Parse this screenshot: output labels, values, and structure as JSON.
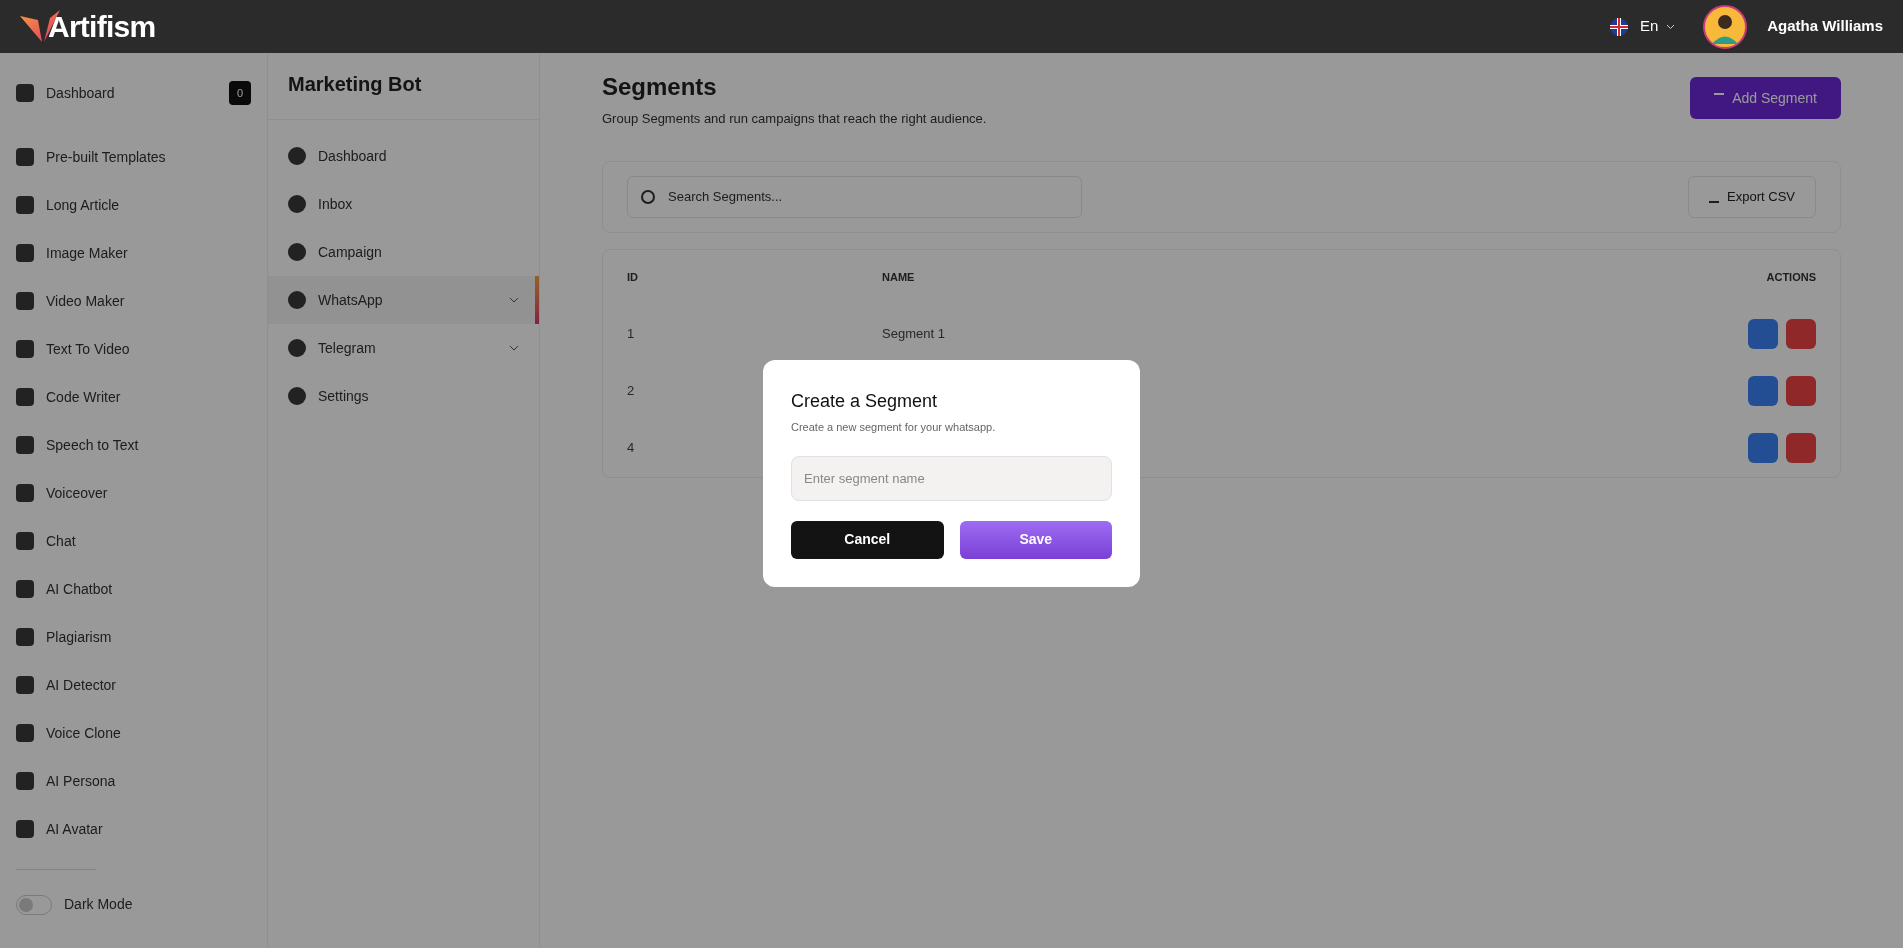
{
  "header": {
    "brand": "Artifism",
    "language": "En",
    "user_name": "Agatha Williams"
  },
  "sidebar": {
    "items": [
      {
        "label": "Dashboard",
        "badge": "0"
      },
      {
        "label": "Pre-built Templates"
      },
      {
        "label": "Long Article"
      },
      {
        "label": "Image Maker"
      },
      {
        "label": "Video Maker"
      },
      {
        "label": "Text To Video"
      },
      {
        "label": "Code Writer"
      },
      {
        "label": "Speech to Text"
      },
      {
        "label": "Voiceover"
      },
      {
        "label": "Chat"
      },
      {
        "label": "AI Chatbot"
      },
      {
        "label": "Plagiarism"
      },
      {
        "label": "AI Detector"
      },
      {
        "label": "Voice Clone"
      },
      {
        "label": "AI Persona"
      },
      {
        "label": "AI Avatar"
      }
    ],
    "dark_mode": {
      "label": "Dark Mode",
      "on": false
    }
  },
  "bot_menu": {
    "title": "Marketing Bot",
    "items": [
      {
        "label": "Dashboard",
        "selected": false,
        "expandable": false
      },
      {
        "label": "Inbox",
        "selected": false,
        "expandable": false
      },
      {
        "label": "Campaign",
        "selected": false,
        "expandable": false
      },
      {
        "label": "WhatsApp",
        "selected": true,
        "expandable": true
      },
      {
        "label": "Telegram",
        "selected": false,
        "expandable": true
      },
      {
        "label": "Settings",
        "selected": false,
        "expandable": false
      }
    ]
  },
  "page": {
    "title": "Segments",
    "subtitle": "Group Segments and run campaigns that reach the right audience.",
    "add_button": "Add Segment",
    "search_placeholder": "Search Segments...",
    "export_button": "Export CSV",
    "table": {
      "columns": [
        "ID",
        "NAME",
        "ACTIONS"
      ],
      "rows": [
        {
          "id": "1",
          "name": "Segment 1"
        },
        {
          "id": "2"
        },
        {
          "id": "4"
        }
      ]
    }
  },
  "dialog": {
    "title": "Create a Segment",
    "description": "Create a new segment for your whatsapp.",
    "name_field": {
      "placeholder": "Enter segment name"
    },
    "cancel": "Cancel",
    "save": "Save"
  }
}
